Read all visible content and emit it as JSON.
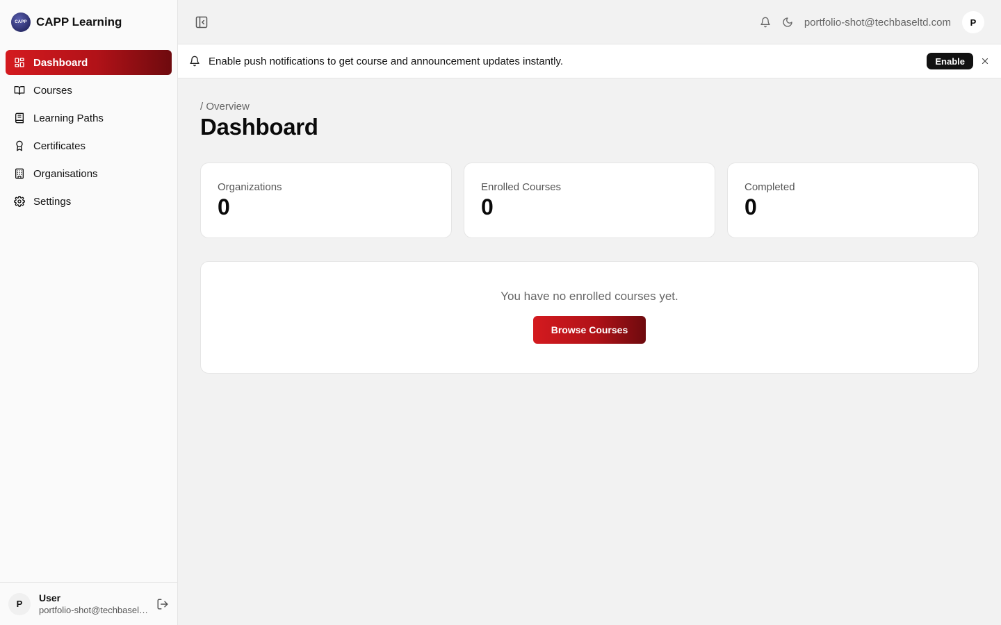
{
  "app": {
    "name": "CAPP Learning",
    "logo_text": "CAPP"
  },
  "sidebar": {
    "items": [
      {
        "label": "Dashboard",
        "icon": "grid-icon",
        "active": true
      },
      {
        "label": "Courses",
        "icon": "book-open-icon"
      },
      {
        "label": "Learning Paths",
        "icon": "notebook-icon"
      },
      {
        "label": "Certificates",
        "icon": "award-icon"
      },
      {
        "label": "Organisations",
        "icon": "building-icon"
      },
      {
        "label": "Settings",
        "icon": "gear-icon"
      }
    ],
    "user": {
      "initial": "P",
      "name": "User",
      "email": "portfolio-shot@techbaseltd.com"
    }
  },
  "topbar": {
    "email": "portfolio-shot@techbaseltd.com",
    "avatar_initial": "P"
  },
  "banner": {
    "text": "Enable push notifications to get course and announcement updates instantly.",
    "enable_label": "Enable"
  },
  "page": {
    "breadcrumb": "/ Overview",
    "title": "Dashboard"
  },
  "stats": [
    {
      "label": "Organizations",
      "value": "0"
    },
    {
      "label": "Enrolled Courses",
      "value": "0"
    },
    {
      "label": "Completed",
      "value": "0"
    }
  ],
  "empty_state": {
    "message": "You have no enrolled courses yet.",
    "button_label": "Browse Courses"
  },
  "colors": {
    "accent_start": "#d41a1f",
    "accent_end": "#6e0a0e",
    "background": "#f2f2f2"
  }
}
